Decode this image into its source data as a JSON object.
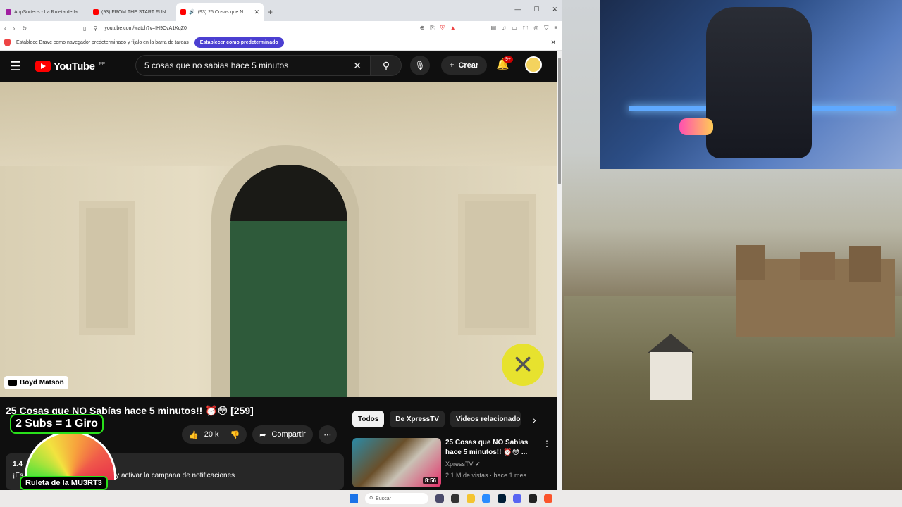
{
  "browser": {
    "tabs": [
      {
        "label": "AppSorteos - La Ruleta de la Suerte",
        "color": "#a11fa1"
      },
      {
        "label": "(93) FROM THE START FUNK (Slowed)",
        "color": "#ff0000"
      },
      {
        "label": "(93) 25 Cosas que NO Sabías",
        "color": "#ff0000"
      }
    ],
    "url": "youtube.com/watch?v=IH9CvA1KqZ0",
    "infobar_text": "Establece Brave como navegador predeterminado y fíjalo en la barra de tareas",
    "infobar_button": "Establecer como predeterminado"
  },
  "youtube": {
    "logo_text": "YouTube",
    "region": "PE",
    "search_value": "5 cosas que no sabias hace 5 minutos",
    "create_label": "Crear",
    "notif_count": "9+",
    "watermark": "Boyd Matson",
    "video_title": "25 Cosas que NO Sabías hace 5 minutos!! ⏰😳 [259]",
    "like_count": "20 k",
    "share_label": "Compartir",
    "desc_views": "1.4",
    "desc_text": "¡Es... deo! No olvides suscribirte y activar la campana de notificaciones",
    "chips": [
      "Todos",
      "De XpressTV",
      "Videos relacionados"
    ],
    "rec": {
      "title": "25 Cosas que NO Sabías hace 5 minutos!! ⏰😳 ...",
      "channel": "XpressTV",
      "meta": "2.1 M de vistas · hace 1 mes",
      "duration": "8:56"
    }
  },
  "overlay": {
    "subs_text": "2 Subs = 1 Giro",
    "ruleta_text": "Ruleta de la MU3RT3"
  },
  "taskbar": {
    "search_placeholder": "Buscar"
  }
}
